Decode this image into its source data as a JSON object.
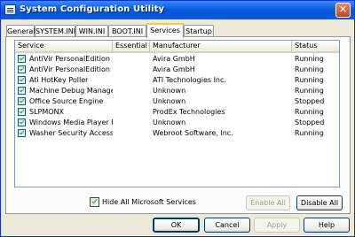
{
  "window": {
    "title": "System Configuration Utility",
    "close_label": "✕"
  },
  "tabs": [
    {
      "label": "General"
    },
    {
      "label": "SYSTEM.INI"
    },
    {
      "label": "WIN.INI"
    },
    {
      "label": "BOOT.INI"
    },
    {
      "label": "Services",
      "active": true
    },
    {
      "label": "Startup"
    }
  ],
  "services_table": {
    "columns": [
      "Service",
      "Essential",
      "Manufacturer",
      "Status"
    ],
    "rows": [
      {
        "service": "AntiVir PersonalEdition Cl...",
        "essential": "",
        "manufacturer": "Avira GmbH",
        "status": "Running",
        "checked": true
      },
      {
        "service": "AntiVir PersonalEdition Cl...",
        "essential": "",
        "manufacturer": "Avira GmbH",
        "status": "Running",
        "checked": true
      },
      {
        "service": "Ati HotKey Poller",
        "essential": "",
        "manufacturer": "ATI Technologies Inc.",
        "status": "Running",
        "checked": true
      },
      {
        "service": "Machine Debug Manager",
        "essential": "",
        "manufacturer": "Unknown",
        "status": "Running",
        "checked": true
      },
      {
        "service": "Office Source Engine",
        "essential": "",
        "manufacturer": "Unknown",
        "status": "Stopped",
        "checked": true
      },
      {
        "service": "SLPMONX",
        "essential": "",
        "manufacturer": "ProdEx Technologies",
        "status": "Running",
        "checked": true
      },
      {
        "service": "Windows Media Player N...",
        "essential": "",
        "manufacturer": "Unknown",
        "status": "Stopped",
        "checked": true
      },
      {
        "service": "Washer Security Access",
        "essential": "",
        "manufacturer": "Webroot Software, Inc.",
        "status": "Running",
        "checked": true
      }
    ]
  },
  "hide_microsoft": {
    "label": "Hide All Microsoft Services",
    "checked": true
  },
  "buttons": {
    "enable_all": "Enable All",
    "disable_all": "Disable All",
    "ok": "OK",
    "cancel": "Cancel",
    "apply": "Apply",
    "help": "Help"
  },
  "colors": {
    "titlebar": "#0A5CE0",
    "face": "#ECE9D8",
    "check": "#21A121"
  }
}
